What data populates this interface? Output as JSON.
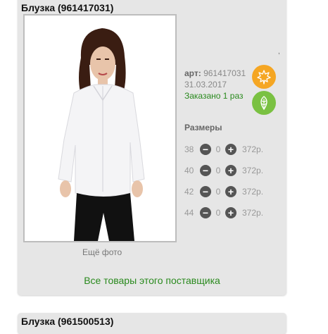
{
  "product": {
    "title": "Блузка (961417031)",
    "art_label": "арт:",
    "art_value": "961417031",
    "date": "31.03.2017",
    "ordered": "Заказано 1 раз",
    "more_photos": "Ещё фото",
    "supplier_link": "Все товары этого поставщика",
    "dot": ","
  },
  "sizes": {
    "title": "Размеры",
    "rows": [
      {
        "size": "38",
        "qty": "0",
        "price": "372р."
      },
      {
        "size": "40",
        "qty": "0",
        "price": "372р."
      },
      {
        "size": "42",
        "qty": "0",
        "price": "372р."
      },
      {
        "size": "44",
        "qty": "0",
        "price": "372р."
      }
    ]
  },
  "next_card": {
    "title": "Блузка (961500513)"
  },
  "icons": {
    "season": "maple-leaf-icon",
    "eco": "leaf-icon",
    "minus": "minus-circle-icon",
    "plus": "plus-circle-icon"
  },
  "colors": {
    "card_bg": "#e6e6e6",
    "green_text": "#2a8a1e",
    "season_badge": "#f5a623",
    "eco_badge": "#7ac142",
    "button": "#555555"
  }
}
